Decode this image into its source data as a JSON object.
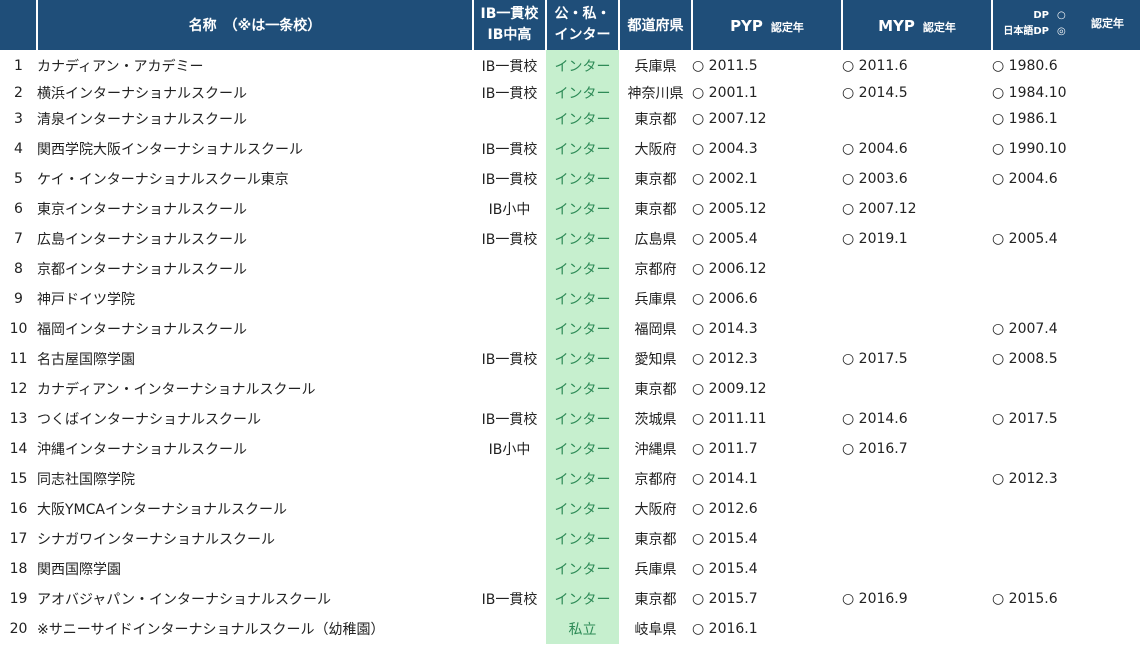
{
  "header": {
    "name": "名称　（※は一条校）",
    "ib_line1": "IB一貫校",
    "ib_line2": "IB中高",
    "type_line1": "公・私・",
    "type_line2": "インター",
    "pref": "都道府県",
    "pyp_big": "PYP",
    "pyp_small": "認定年",
    "myp_big": "MYP",
    "myp_small": "認定年",
    "dp_label1": "DP",
    "dp_label2": "日本語DP",
    "dp_sym1": "○",
    "dp_sym2": "◎",
    "dp_small": "認定年"
  },
  "rows": [
    {
      "no": "1",
      "name": "カナディアン・アカデミー",
      "ib": "IB一貫校",
      "type": "インター",
      "pref": "兵庫県",
      "pyp": "○ 2011.5",
      "myp": "○ 2011.6",
      "dp": "○ 1980.6"
    },
    {
      "no": "2",
      "name": "横浜インターナショナルスクール",
      "ib": "IB一貫校",
      "type": "インター",
      "pref": "神奈川県",
      "pyp": "○ 2001.1",
      "myp": "○ 2014.5",
      "dp": "○ 1984.10"
    },
    {
      "no": "3",
      "name": "清泉インターナショナルスクール",
      "ib": "",
      "type": "インター",
      "pref": "東京都",
      "pyp": "○ 2007.12",
      "myp": "",
      "dp": "○ 1986.1"
    },
    {
      "no": "4",
      "name": "関西学院大阪インターナショナルスクール",
      "ib": "IB一貫校",
      "type": "インター",
      "pref": "大阪府",
      "pyp": "○ 2004.3",
      "myp": "○ 2004.6",
      "dp": "○ 1990.10"
    },
    {
      "no": "5",
      "name": "ケイ・インターナショナルスクール東京",
      "ib": "IB一貫校",
      "type": "インター",
      "pref": "東京都",
      "pyp": "○ 2002.1",
      "myp": "○ 2003.6",
      "dp": "○ 2004.6"
    },
    {
      "no": "6",
      "name": "東京インターナショナルスクール",
      "ib": "IB小中",
      "type": "インター",
      "pref": "東京都",
      "pyp": "○ 2005.12",
      "myp": "○ 2007.12",
      "dp": ""
    },
    {
      "no": "7",
      "name": "広島インターナショナルスクール",
      "ib": "IB一貫校",
      "type": "インター",
      "pref": "広島県",
      "pyp": "○ 2005.4",
      "myp": "○ 2019.1",
      "dp": "○ 2005.4"
    },
    {
      "no": "8",
      "name": "京都インターナショナルスクール",
      "ib": "",
      "type": "インター",
      "pref": "京都府",
      "pyp": "○ 2006.12",
      "myp": "",
      "dp": ""
    },
    {
      "no": "9",
      "name": "神戸ドイツ学院",
      "ib": "",
      "type": "インター",
      "pref": "兵庫県",
      "pyp": "○ 2006.6",
      "myp": "",
      "dp": ""
    },
    {
      "no": "10",
      "name": "福岡インターナショナルスクール",
      "ib": "",
      "type": "インター",
      "pref": "福岡県",
      "pyp": "○ 2014.3",
      "myp": "",
      "dp": "○ 2007.4"
    },
    {
      "no": "11",
      "name": "名古屋国際学園",
      "ib": "IB一貫校",
      "type": "インター",
      "pref": "愛知県",
      "pyp": "○ 2012.3",
      "myp": "○ 2017.5",
      "dp": "○ 2008.5"
    },
    {
      "no": "12",
      "name": "カナディアン・インターナショナルスクール",
      "ib": "",
      "type": "インター",
      "pref": "東京都",
      "pyp": "○ 2009.12",
      "myp": "",
      "dp": ""
    },
    {
      "no": "13",
      "name": "つくばインターナショナルスクール",
      "ib": "IB一貫校",
      "type": "インター",
      "pref": "茨城県",
      "pyp": "○ 2011.11",
      "myp": "○ 2014.6",
      "dp": "○ 2017.5"
    },
    {
      "no": "14",
      "name": "沖縄インターナショナルスクール",
      "ib": "IB小中",
      "type": "インター",
      "pref": "沖縄県",
      "pyp": "○ 2011.7",
      "myp": "○ 2016.7",
      "dp": ""
    },
    {
      "no": "15",
      "name": "同志社国際学院",
      "ib": "",
      "type": "インター",
      "pref": "京都府",
      "pyp": "○ 2014.1",
      "myp": "",
      "dp": "○ 2012.3"
    },
    {
      "no": "16",
      "name": "大阪YMCAインターナショナルスクール",
      "ib": "",
      "type": "インター",
      "pref": "大阪府",
      "pyp": "○ 2012.6",
      "myp": "",
      "dp": ""
    },
    {
      "no": "17",
      "name": "シナガワインターナショナルスクール",
      "ib": "",
      "type": "インター",
      "pref": "東京都",
      "pyp": "○ 2015.4",
      "myp": "",
      "dp": ""
    },
    {
      "no": "18",
      "name": "関西国際学園",
      "ib": "",
      "type": "インター",
      "pref": "兵庫県",
      "pyp": "○ 2015.4",
      "myp": "",
      "dp": ""
    },
    {
      "no": "19",
      "name": "アオバジャパン・インターナショナルスクール",
      "ib": "IB一貫校",
      "type": "インター",
      "pref": "東京都",
      "pyp": "○ 2015.7",
      "myp": "○ 2016.9",
      "dp": "○ 2015.6"
    },
    {
      "no": "20",
      "name": "※サニーサイドインターナショナルスクール（幼稚園）",
      "ib": "",
      "type": "私立",
      "pref": "岐阜県",
      "pyp": "○ 2016.1",
      "myp": "",
      "dp": ""
    }
  ]
}
